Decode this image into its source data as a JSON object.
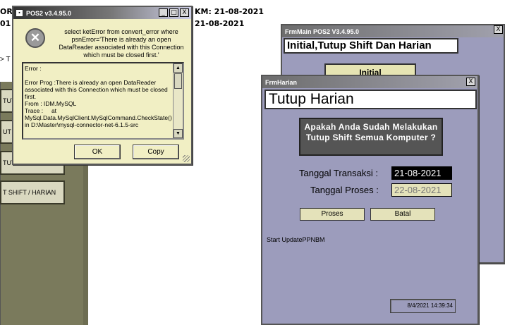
{
  "background": {
    "top_left_text_1": "OR",
    "top_left_text_2": "01",
    "top_date_label": "KM: 21-08-2021",
    "top_date_value": "21-08-2021",
    "arrow_text": "> T",
    "buttons": [
      "TUTU",
      "UT A",
      "TUTU",
      "T SHIFT / HARIAN"
    ]
  },
  "error_dialog": {
    "title": "POS2 v3.4.95.0",
    "icon": "error-x-icon",
    "message": "select ketError from convert_error where psnError='There is already an open DataReader associated with this Connection which must be closed first.'",
    "details": "Error :\n\nError Prog :There is already an open DataReader associated with this Connection which must be closed first.\nFrom : IDM.MySQL\nTrace :     at MySql.Data.MySqlClient.MySqlCommand.CheckState() in D:\\Master\\mysql-connector-net-6.1.5-src",
    "ok_label": "OK",
    "copy_label": "Copy",
    "controls": {
      "minimize": "_",
      "maximize": "□",
      "close": "X"
    }
  },
  "frm_main": {
    "title": "FrmMain POS2 V3.4.95.0",
    "header": "Initial,Tutup Shift Dan Harian",
    "button_label": "Initial",
    "close": "X"
  },
  "frm_harian": {
    "title": "FrmHarian",
    "header": "Tutup Harian",
    "question": "Apakah Anda Sudah Melakukan Tutup Shift Semua Komputer ?",
    "tanggal_transaksi_label": "Tanggal Transaksi :",
    "tanggal_transaksi_value": "21-08-2021",
    "tanggal_proses_label": "Tanggal Proses :",
    "tanggal_proses_value": "22-08-2021",
    "proses_label": "Proses",
    "batal_label": "Batal",
    "status_text": "Start UpdatePPNBM",
    "timestamp": "8/4/2021 14:39:34",
    "close": "X"
  }
}
